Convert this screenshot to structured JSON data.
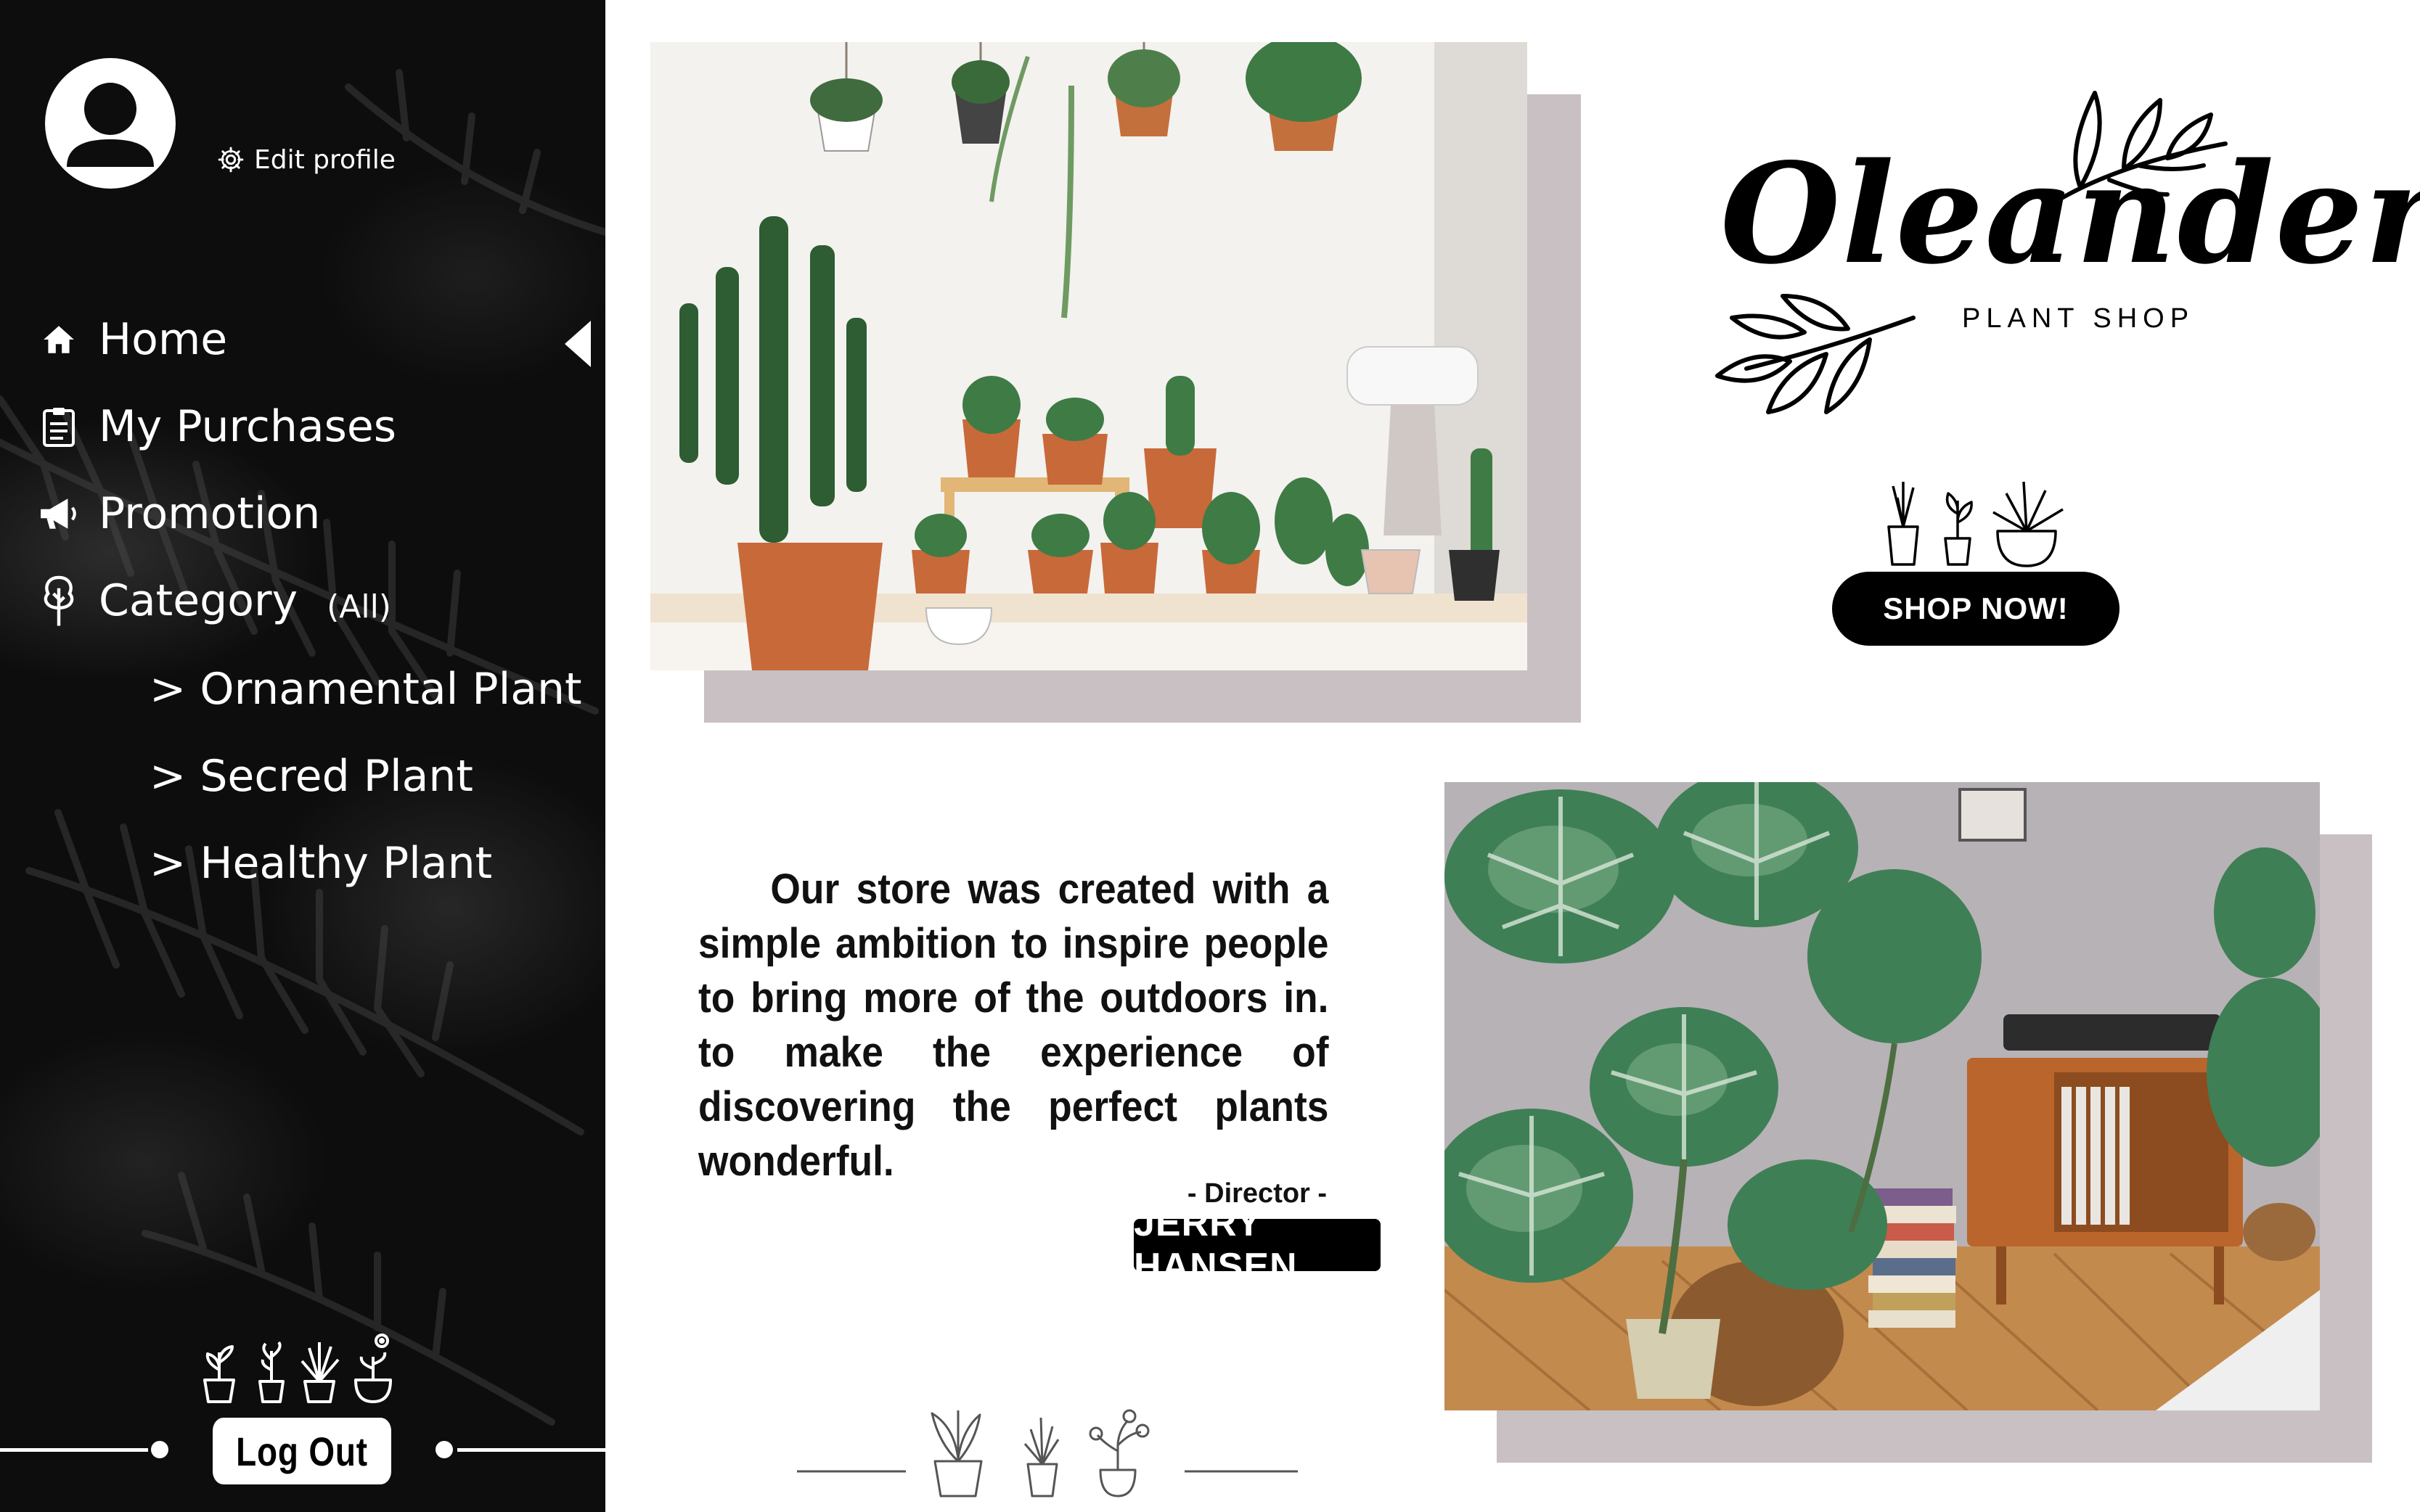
{
  "sidebar": {
    "edit_profile_label": "Edit profile",
    "nav": [
      {
        "label": "Home",
        "icon": "home-icon",
        "active": true
      },
      {
        "label": "My Purchases",
        "icon": "clipboard-icon"
      },
      {
        "label": "Promotion",
        "icon": "megaphone-icon"
      },
      {
        "label": "Category",
        "note": "(All)",
        "icon": "tree-icon"
      }
    ],
    "subcategories": [
      "> Ornamental Plant",
      "> Secred Plant",
      "> Healthy Plant"
    ],
    "logout_label": "Log Out"
  },
  "brand": {
    "name": "Oleander",
    "tagline": "PLANT SHOP"
  },
  "shop_button_label": "SHOP NOW!",
  "quote": "Our store was created with a simple ambition to inspire people to bring more of the outdoors in. to make the experience of discovering the perfect plants wonderful.",
  "director": {
    "role": "- Director -",
    "name": "JERRY HANSEN"
  },
  "colors": {
    "sidebar_bg": "#0d0d0d",
    "photo_shadow": "#c9c0c3",
    "accent": "#000000"
  }
}
